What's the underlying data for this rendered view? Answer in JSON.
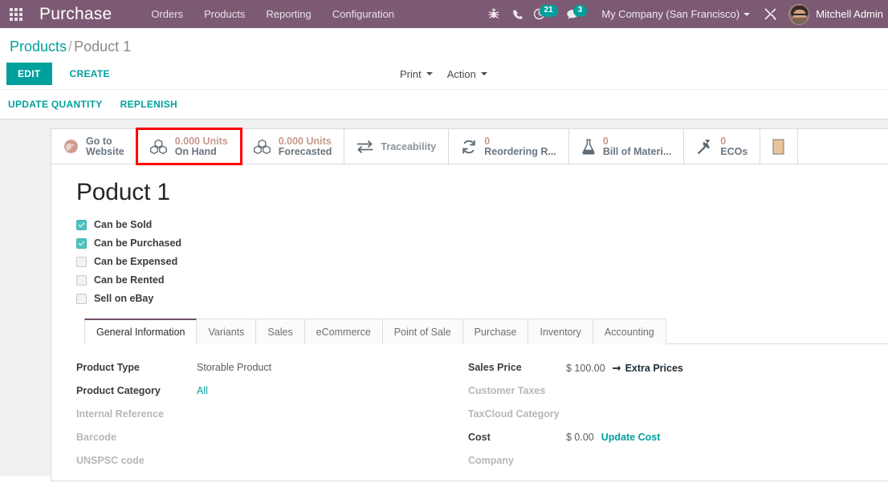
{
  "navbar": {
    "apps_icon": "apps-grid-icon",
    "brand": "Purchase",
    "menu": [
      {
        "label": "Orders"
      },
      {
        "label": "Products"
      },
      {
        "label": "Reporting"
      },
      {
        "label": "Configuration"
      }
    ],
    "icons": [
      {
        "name": "bug-icon"
      },
      {
        "name": "phone-icon"
      }
    ],
    "activities_badge": "21",
    "messages_badge": "3",
    "company": "My Company (San Francisco)",
    "debug_icon": "wrench-screwdriver-icon",
    "user_name": "Mitchell Admin"
  },
  "breadcrumb": {
    "root": "Products",
    "separator": "/",
    "current": "Poduct 1"
  },
  "control_panel": {
    "edit_label": "EDIT",
    "create_label": "CREATE",
    "print_label": "Print",
    "action_label": "Action"
  },
  "sub_actions": [
    {
      "label": "UPDATE QUANTITY"
    },
    {
      "label": "REPLENISH"
    }
  ],
  "smart_buttons": [
    {
      "icon": "globe-icon",
      "value": "",
      "line1": "Go to",
      "line2": "Website",
      "highlighted": false
    },
    {
      "icon": "boxes-icon",
      "value": "0.000 Units",
      "line2": "On Hand",
      "highlighted": true
    },
    {
      "icon": "boxes-icon",
      "value": "0.000 Units",
      "line2": "Forecasted",
      "highlighted": false
    },
    {
      "icon": "exchange-arrows-icon",
      "value": "",
      "line2": "Traceability",
      "highlighted": false
    },
    {
      "icon": "refresh-icon",
      "value": "0",
      "line2": "Reordering R...",
      "highlighted": false
    },
    {
      "icon": "flask-icon",
      "value": "0",
      "line2": "Bill of Materi...",
      "highlighted": false
    },
    {
      "icon": "wrench-icon",
      "value": "0",
      "line2": "ECOs",
      "highlighted": false
    }
  ],
  "product": {
    "title": "Poduct 1",
    "checkboxes": [
      {
        "label": "Can be Sold",
        "checked": true
      },
      {
        "label": "Can be Purchased",
        "checked": true
      },
      {
        "label": "Can be Expensed",
        "checked": false
      },
      {
        "label": "Can be Rented",
        "checked": false
      },
      {
        "label": "Sell on eBay",
        "checked": false
      }
    ]
  },
  "tabs": [
    {
      "label": "General Information",
      "active": true
    },
    {
      "label": "Variants",
      "active": false
    },
    {
      "label": "Sales",
      "active": false
    },
    {
      "label": "eCommerce",
      "active": false
    },
    {
      "label": "Point of Sale",
      "active": false
    },
    {
      "label": "Purchase",
      "active": false
    },
    {
      "label": "Inventory",
      "active": false
    },
    {
      "label": "Accounting",
      "active": false
    }
  ],
  "general_information": {
    "left": [
      {
        "label": "Product Type",
        "value": "Storable Product",
        "empty": false,
        "link": false
      },
      {
        "label": "Product Category",
        "value": "All",
        "empty": false,
        "link": true
      },
      {
        "label": "Internal Reference",
        "value": "",
        "empty": true,
        "link": false
      },
      {
        "label": "Barcode",
        "value": "",
        "empty": true,
        "link": false
      },
      {
        "label": "UNSPSC code",
        "value": "",
        "empty": true,
        "link": false
      }
    ],
    "right": [
      {
        "label": "Sales Price",
        "value": "$ 100.00",
        "action": "Extra Prices",
        "action_arrow": true,
        "empty": false
      },
      {
        "label": "Customer Taxes",
        "value": "",
        "action": "",
        "empty": true
      },
      {
        "label": "TaxCloud Category",
        "value": "",
        "action": "",
        "empty": true
      },
      {
        "label": "Cost",
        "value": "$ 0.00",
        "action": "Update Cost",
        "action_arrow": false,
        "empty": false
      },
      {
        "label": "Company",
        "value": "",
        "action": "",
        "empty": true
      }
    ]
  },
  "colors": {
    "navbar": "#7C5A73",
    "accent_teal": "#00A09D",
    "highlight_red": "#FF0000",
    "smart_value": "#C8998E",
    "tab_active_border": "#6E4D68"
  }
}
